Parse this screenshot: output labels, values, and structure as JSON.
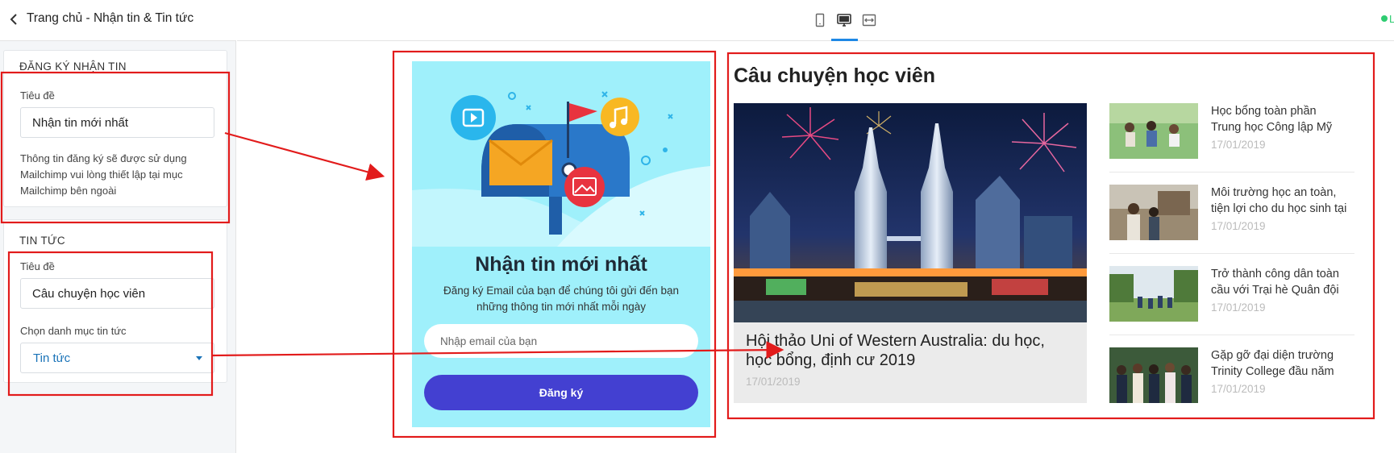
{
  "sidebar": {
    "title": "Trang chủ - Nhận tin & Tin tức",
    "subscribe_section": {
      "heading": "ĐĂNG KÝ NHẬN TIN",
      "title_label": "Tiêu đề",
      "title_value": "Nhận tin mới nhất",
      "help_lines": [
        "Thông tin đăng ký sẽ được sử dụng",
        "Mailchimp vui lòng thiết lập tại mục",
        "Mailchimp bên ngoài"
      ]
    },
    "news_section": {
      "heading": "TIN TỨC",
      "title_label": "Tiêu đề",
      "title_value": "Câu chuyện học viên",
      "category_label": "Chọn danh mục tin tức",
      "category_value": "Tin tức"
    }
  },
  "topbar": {
    "devices": [
      "mobile-icon",
      "desktop-icon",
      "fullwidth-icon"
    ],
    "active_device": "desktop-icon",
    "accent": "#1e88e5",
    "status_text": "L"
  },
  "newsletter": {
    "title": "Nhận tin mới nhất",
    "desc_lines": [
      "Đăng ký Email của bạn để chúng tôi gửi đến bạn",
      "những thông tin mới nhất mỗi ngày"
    ],
    "email_placeholder": "Nhập email của bạn",
    "submit_label": "Đăng ký",
    "bg_color": "#9ff0fb",
    "button_color": "#4340d1"
  },
  "news": {
    "title": "Câu chuyện học viên",
    "featured": {
      "caption_lines": [
        "Hội thảo Uni of Western Australia: du học,",
        "học bổng, định cư 2019"
      ],
      "date": "17/01/2019"
    },
    "items": [
      {
        "title_lines": [
          "Học bổng toàn phần",
          "Trung học Công lập Mỹ"
        ],
        "date": "17/01/2019"
      },
      {
        "title_lines": [
          "Môi trường học an toàn,",
          "tiện lợi cho du học sinh tại"
        ],
        "date": "17/01/2019"
      },
      {
        "title_lines": [
          "Trở thành công dân toàn",
          "cầu với Trại hè Quân đội"
        ],
        "date": "17/01/2019"
      },
      {
        "title_lines": [
          "Gặp gỡ đại diện trường",
          "Trinity College đầu năm"
        ],
        "date": "17/01/2019"
      }
    ]
  },
  "annotation_color": "#e21b1b"
}
